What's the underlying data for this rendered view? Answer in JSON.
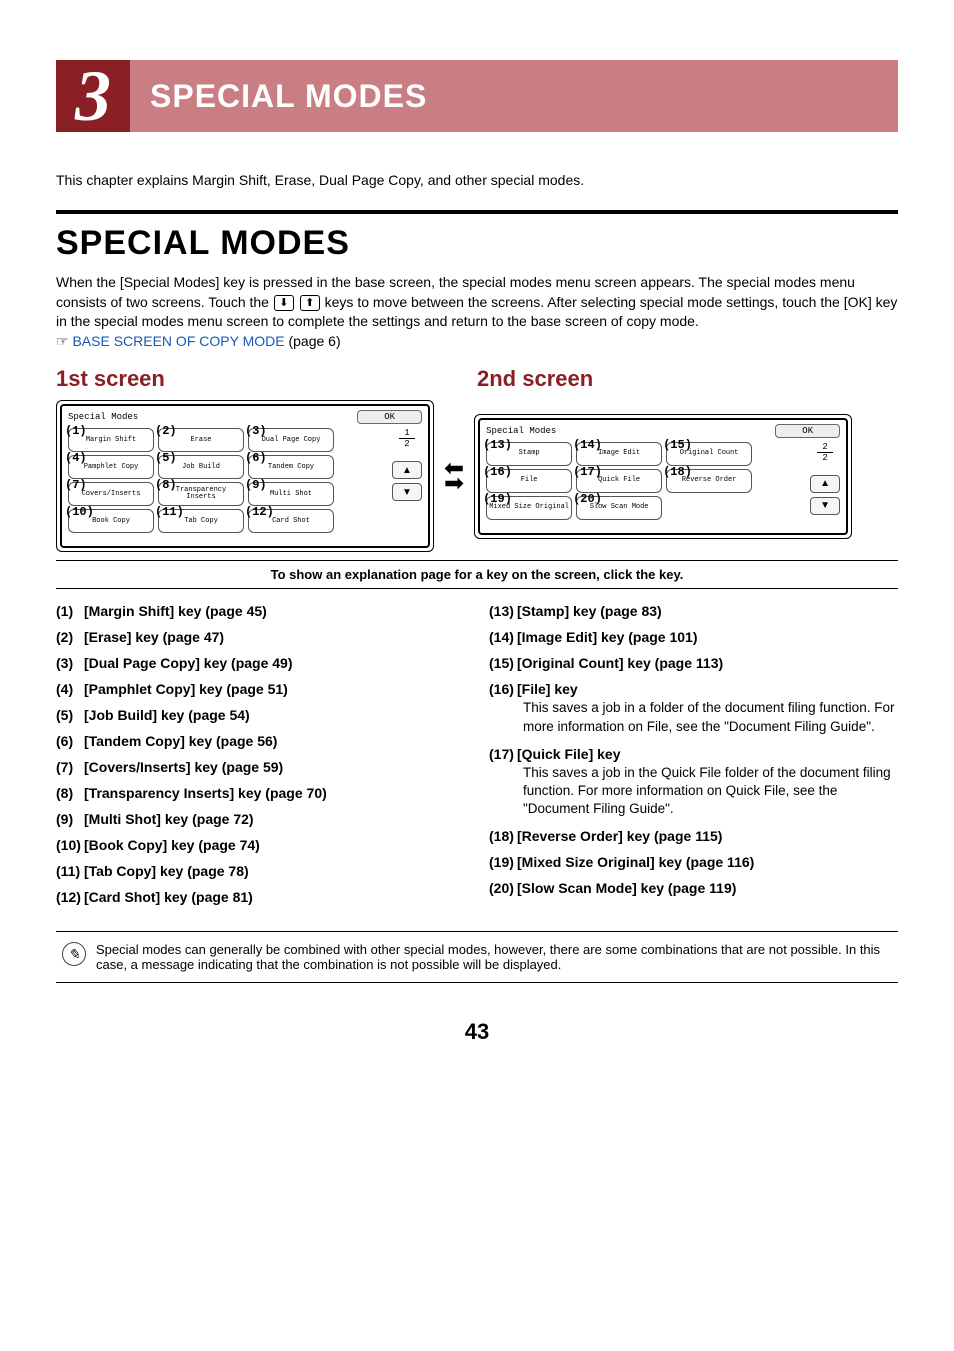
{
  "chapter": {
    "number": "3",
    "title": "SPECIAL MODES"
  },
  "intro": "This chapter explains Margin Shift, Erase, Dual Page Copy, and other special modes.",
  "section_title": "SPECIAL MODES",
  "para_before": "When the [Special Modes] key is pressed in the base screen, the special modes menu screen appears. The special modes menu consists of two screens. Touch the ",
  "para_after": " keys to move between the screens. After selecting special mode settings, touch the [OK] key in the special modes menu screen to complete the settings and return to the base screen of copy mode.",
  "link_text": "BASE SCREEN OF COPY MODE",
  "link_page": " (page 6)",
  "first_head": "1st screen",
  "second_head": "2nd screen",
  "screen1": {
    "title": "Special Modes",
    "ok": "OK",
    "page_top": "1",
    "page_bottom": "2",
    "keys": [
      {
        "n": "(1)",
        "label": "Margin Shift"
      },
      {
        "n": "(2)",
        "label": "Erase"
      },
      {
        "n": "(3)",
        "label": "Dual Page Copy"
      },
      {
        "n": "(4)",
        "label": "Pamphlet Copy"
      },
      {
        "n": "(5)",
        "label": "Job Build"
      },
      {
        "n": "(6)",
        "label": "Tandem Copy"
      },
      {
        "n": "(7)",
        "label": "Covers/Inserts"
      },
      {
        "n": "(8)",
        "label": "Transparency Inserts"
      },
      {
        "n": "(9)",
        "label": "Multi Shot"
      },
      {
        "n": "(10)",
        "label": "Book Copy"
      },
      {
        "n": "(11)",
        "label": "Tab Copy"
      },
      {
        "n": "(12)",
        "label": "Card Shot"
      }
    ]
  },
  "screen2": {
    "title": "Special Modes",
    "ok": "OK",
    "page_top": "2",
    "page_bottom": "2",
    "keys": [
      {
        "n": "(13)",
        "label": "Stamp"
      },
      {
        "n": "(14)",
        "label": "Image Edit"
      },
      {
        "n": "(15)",
        "label": "Original Count"
      },
      {
        "n": "(16)",
        "label": "File"
      },
      {
        "n": "(17)",
        "label": "Quick File"
      },
      {
        "n": "(18)",
        "label": "Reverse Order"
      },
      {
        "n": "(19)",
        "label": "Mixed Size Original"
      },
      {
        "n": "(20)",
        "label": "Slow Scan Mode"
      }
    ]
  },
  "caption": "To show an explanation page for a key on the screen, click the key.",
  "list_left": [
    {
      "n": "(1)",
      "t": "[Margin Shift] key  (page 45)"
    },
    {
      "n": "(2)",
      "t": "[Erase] key (page 47)"
    },
    {
      "n": "(3)",
      "t": "[Dual Page Copy] key (page 49)"
    },
    {
      "n": "(4)",
      "t": "[Pamphlet Copy] key (page 51)"
    },
    {
      "n": "(5)",
      "t": "[Job Build] key (page 54)"
    },
    {
      "n": "(6)",
      "t": "[Tandem Copy] key (page 56)"
    },
    {
      "n": "(7)",
      "t": "[Covers/Inserts] key (page 59)"
    },
    {
      "n": "(8)",
      "t": "[Transparency Inserts] key (page 70)"
    },
    {
      "n": "(9)",
      "t": "[Multi Shot] key (page 72)"
    },
    {
      "n": "(10)",
      "t": "[Book Copy] key (page 74)"
    },
    {
      "n": "(11)",
      "t": "[Tab Copy] key (page 78)"
    },
    {
      "n": "(12)",
      "t": "[Card Shot] key (page 81)"
    }
  ],
  "list_right": [
    {
      "n": "(13)",
      "t": "[Stamp] key (page 83)"
    },
    {
      "n": "(14)",
      "t": "[Image Edit] key (page 101)"
    },
    {
      "n": "(15)",
      "t": "[Original Count] key (page 113)"
    },
    {
      "n": "(16)",
      "t": "[File] key",
      "d": "This saves a job in a folder of the document filing function. For more information on File, see the \"Document Filing Guide\"."
    },
    {
      "n": "(17)",
      "t": "[Quick File] key",
      "d": "This saves a job in the Quick File folder of the document filing function. For more information on Quick File, see the \"Document Filing Guide\"."
    },
    {
      "n": "(18)",
      "t": "[Reverse Order] key (page 115)"
    },
    {
      "n": "(19)",
      "t": "[Mixed Size Original] key (page 116)"
    },
    {
      "n": "(20)",
      "t": "[Slow Scan Mode] key (page 119)"
    }
  ],
  "note": "Special modes can generally be combined with other special modes, however, there are some combinations that are not possible. In this case, a message indicating that the combination is not possible will be displayed.",
  "page_number": "43"
}
